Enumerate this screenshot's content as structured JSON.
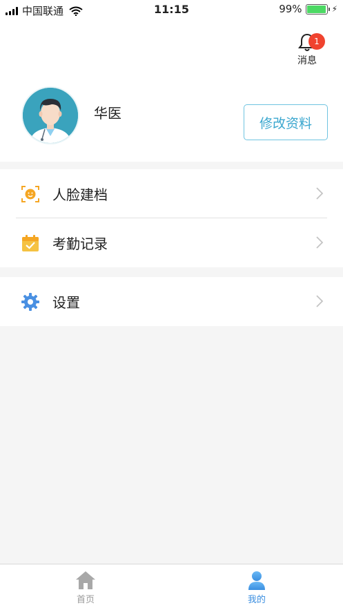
{
  "status_bar": {
    "carrier": "中国联通",
    "time": "11:15",
    "battery": "99%",
    "battery_level": 0.99
  },
  "header": {
    "message_label": "消息",
    "message_badge": "1",
    "user_name": "华医",
    "edit_profile_label": "修改资料"
  },
  "menu": {
    "face_filing": "人脸建档",
    "attendance": "考勤记录",
    "settings": "设置"
  },
  "tabbar": {
    "home": "首页",
    "mine": "我的"
  },
  "colors": {
    "accent": "#3ba7cf",
    "badge": "#f0432f",
    "active_tab": "#3a8ee0",
    "icon_orange": "#f5a623",
    "icon_blue": "#4a90e2"
  },
  "icons": [
    "signal-icon",
    "wifi-icon",
    "battery-icon",
    "bell-icon",
    "face-scan-icon",
    "calendar-check-icon",
    "gear-icon",
    "chevron-right-icon",
    "home-icon",
    "person-icon"
  ]
}
